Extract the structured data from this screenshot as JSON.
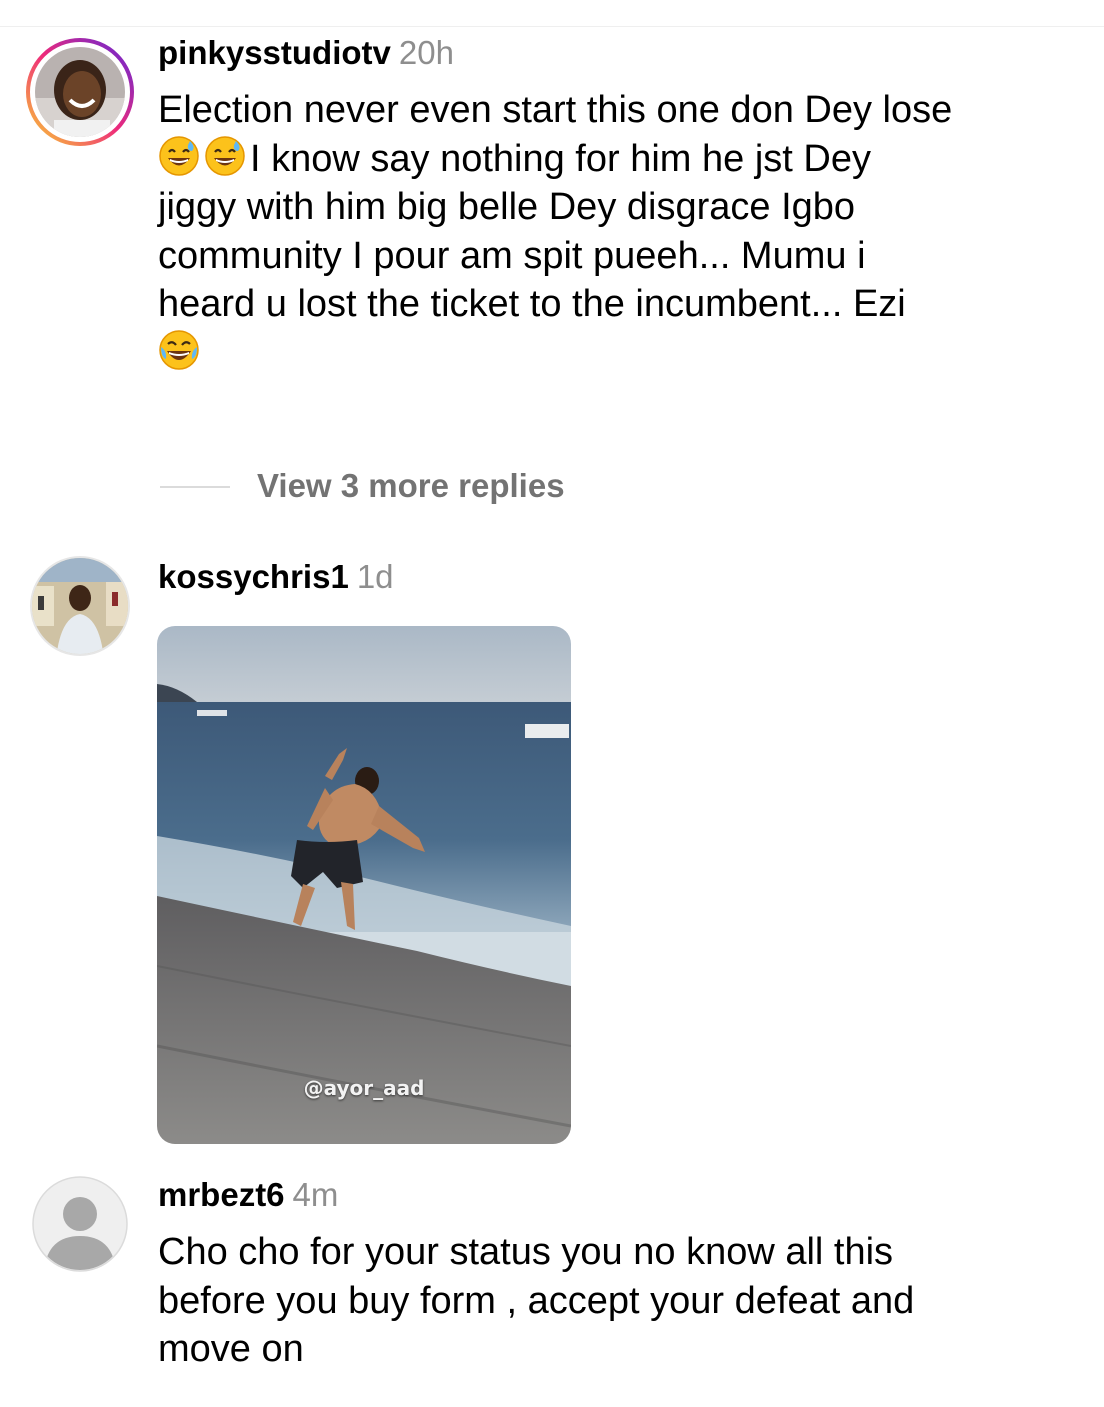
{
  "comments": [
    {
      "username": "pinkysstudiotv",
      "time": "20h",
      "line1": "Election never even start this one don Dey lose",
      "line2_emojis": [
        "sweat-smile-emoji",
        "sweat-smile-emoji"
      ],
      "line2": "I know say nothing for him he jst Dey",
      "line3": "jiggy with him big belle Dey disgrace Igbo",
      "line4": "community I pour am spit pueeh... Mumu i",
      "line5": "heard u lost the ticket to the incumbent... Ezi",
      "line6_emoji": "joy-emoji"
    },
    {
      "username": "kossychris1",
      "time": "1d",
      "gif_watermark": "@ayor_aad"
    },
    {
      "username": "mrbezt6",
      "time": "4m",
      "line1": "Cho cho for your status you no know all this",
      "line2": "before you buy form , accept your defeat and",
      "line3": "move on"
    }
  ],
  "view_replies": "View 3 more replies",
  "colors": {
    "story_ring_start": "#f9ce34",
    "story_ring_mid": "#ee2a7b",
    "story_ring_end": "#6228d7",
    "muted": "#8e8e8e"
  }
}
